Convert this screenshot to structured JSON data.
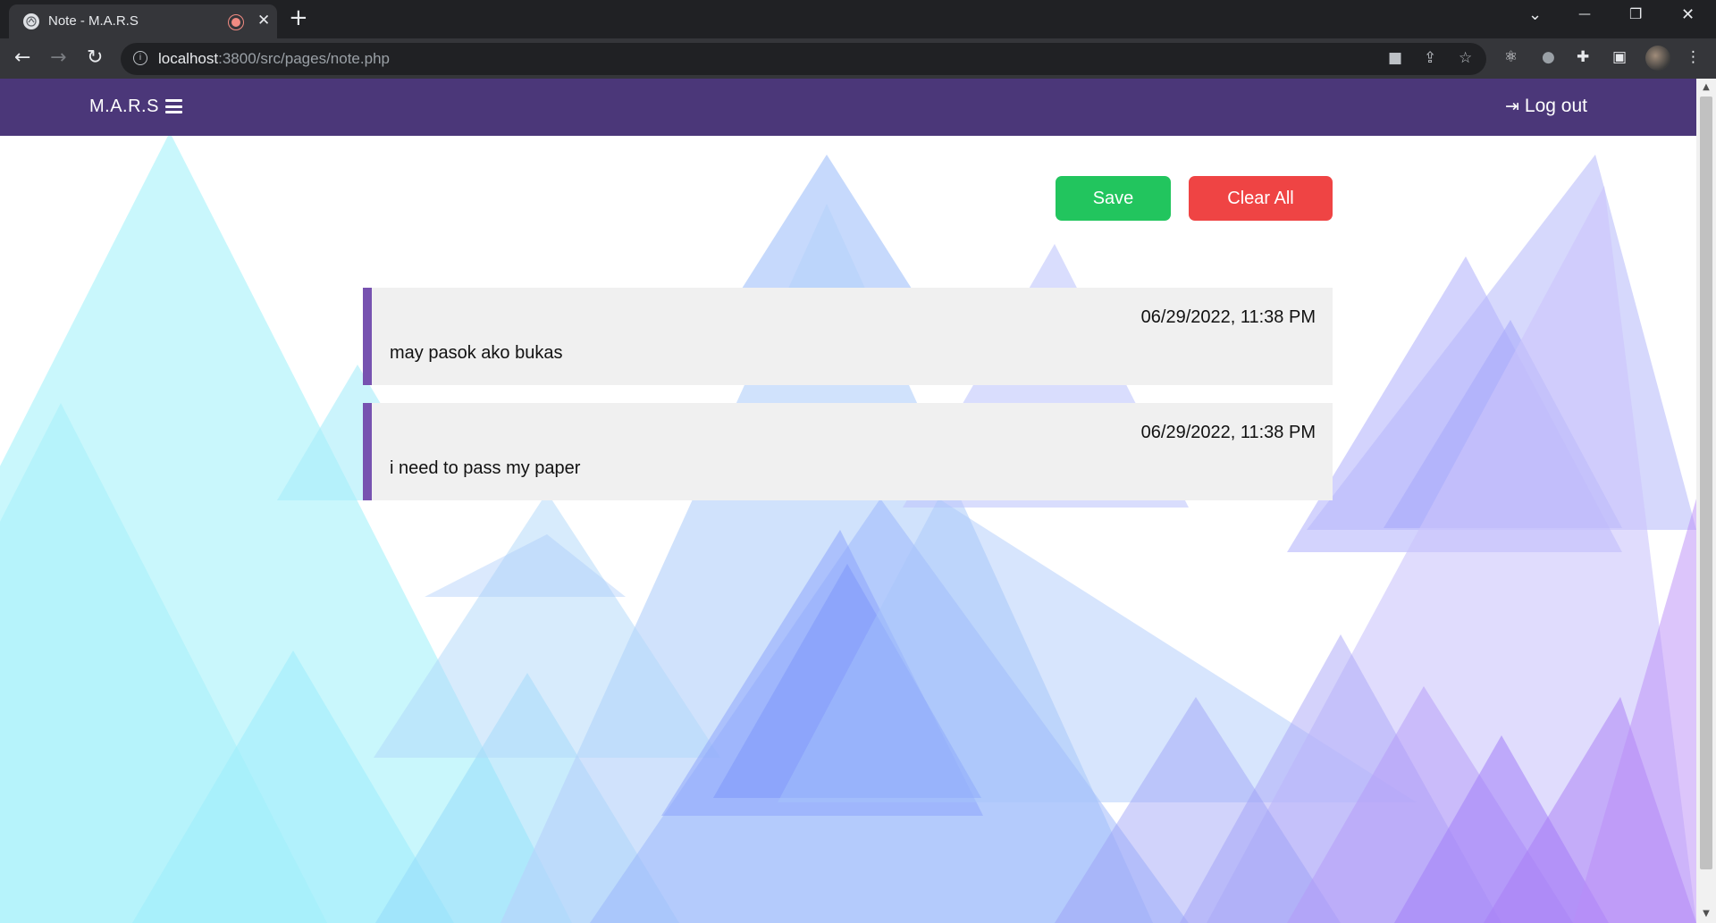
{
  "browser": {
    "tab_title": "Note - M.A.R.S",
    "tab_close": "✕",
    "new_tab": "+",
    "url_host": "localhost",
    "url_rest": ":3800/src/pages/note.php",
    "window_controls": {
      "dropdown": "⌄",
      "minimize": "—",
      "restore": "❐",
      "close": "✕"
    }
  },
  "app": {
    "brand": "M.A.R.S",
    "logout_label": "Log out"
  },
  "actions": {
    "save_label": "Save",
    "clear_label": "Clear All"
  },
  "notes": [
    {
      "date": "06/29/2022, 11:38 PM",
      "text": "may pasok ako bukas"
    },
    {
      "date": "06/29/2022, 11:38 PM",
      "text": "i need to pass my paper"
    }
  ],
  "colors": {
    "navbar": "#4b3779",
    "save": "#22c55e",
    "clear": "#ef4444",
    "note_bg": "#f0f0f0",
    "note_accent": "#7752b0"
  }
}
